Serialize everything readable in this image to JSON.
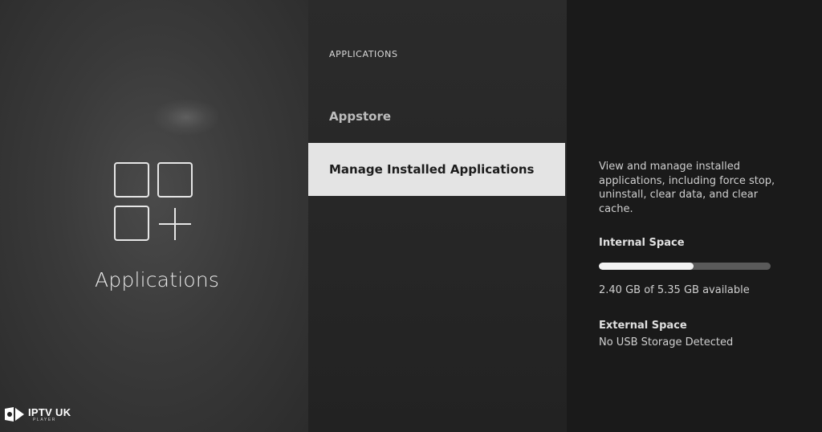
{
  "left": {
    "title": "Applications",
    "icon": "apps-grid-plus-icon",
    "watermark": {
      "main": "IPTV UK",
      "sub": "PLAYER"
    }
  },
  "menu": {
    "header": "APPLICATIONS",
    "items": [
      {
        "label": "Appstore",
        "selected": false
      },
      {
        "label": "Manage Installed Applications",
        "selected": true
      }
    ]
  },
  "details": {
    "description": "View and manage installed applications, including force stop, uninstall, clear data, and clear cache.",
    "internal": {
      "label": "Internal Space",
      "value": "2.40 GB of 5.35 GB available",
      "used_fraction": 0.552
    },
    "external": {
      "label": "External Space",
      "value": "No USB Storage Detected"
    }
  },
  "colors": {
    "selected_bg": "#e4e4e4",
    "bar_fill": "#f2f2f2",
    "bar_track": "#5a5a5a"
  }
}
